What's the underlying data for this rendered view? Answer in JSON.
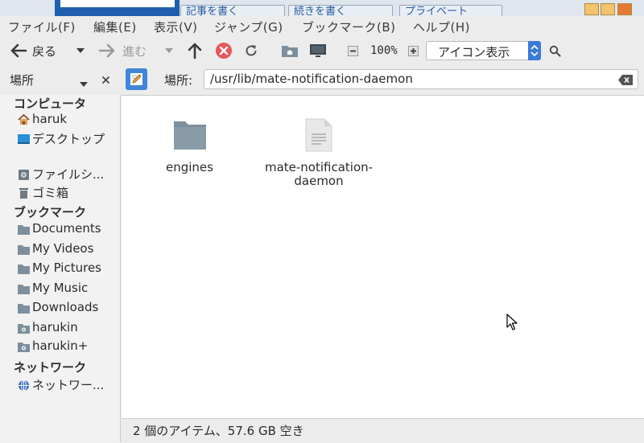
{
  "background_window": {
    "buttons": [
      "記事を書く",
      "続きを書く",
      "プライベート"
    ],
    "window_controls": [
      "minimize",
      "maximize",
      "close"
    ]
  },
  "menubar": {
    "items": [
      "ファイル(F)",
      "編集(E)",
      "表示(V)",
      "ジャンプ(G)",
      "ブックマーク(B)",
      "ヘルプ(H)"
    ]
  },
  "toolbar": {
    "back_label": "戻る",
    "forward_label": "進む",
    "zoom_level": "100%",
    "view_mode": "アイコン表示"
  },
  "sidebar": {
    "title": "場所",
    "sections": [
      {
        "heading": "コンピュータ",
        "items": [
          {
            "label": "haruk",
            "icon": "home-icon"
          },
          {
            "label": "デスクトップ",
            "icon": "desktop-icon"
          },
          {
            "label": "ファイルシ...",
            "icon": "drive-icon"
          },
          {
            "label": "ゴミ箱",
            "icon": "trash-icon"
          }
        ]
      },
      {
        "heading": "ブックマーク",
        "items": [
          {
            "label": "Documents",
            "icon": "folder-icon"
          },
          {
            "label": "My Videos",
            "icon": "folder-icon"
          },
          {
            "label": "My Pictures",
            "icon": "folder-icon"
          },
          {
            "label": "My Music",
            "icon": "folder-icon"
          },
          {
            "label": "Downloads",
            "icon": "folder-icon"
          },
          {
            "label": "harukin",
            "icon": "network-folder-icon"
          },
          {
            "label": "harukin+",
            "icon": "network-folder-icon"
          }
        ]
      },
      {
        "heading": "ネットワーク",
        "items": [
          {
            "label": "ネットワー...",
            "icon": "network-icon"
          }
        ]
      }
    ]
  },
  "location": {
    "label": "場所:",
    "path": "/usr/lib/mate-notification-daemon"
  },
  "files": [
    {
      "name": "engines",
      "type": "folder"
    },
    {
      "name": "mate-notification-daemon",
      "name_lines": [
        "mate-notification-",
        "daemon"
      ],
      "type": "file"
    }
  ],
  "status": "2 個のアイテム、57.6 GB 空き",
  "colors": {
    "accent": "#3a7bd5",
    "folder": "#7d8f9c",
    "stop": "#e4585b"
  }
}
